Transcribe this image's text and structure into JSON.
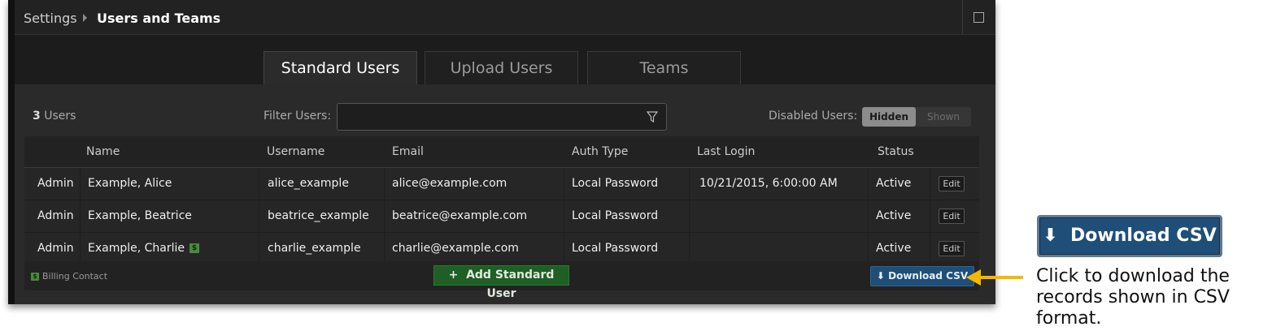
{
  "breadcrumb": {
    "root": "Settings",
    "current": "Users and Teams"
  },
  "tabs": [
    {
      "label": "Standard Users",
      "active": true
    },
    {
      "label": "Upload Users",
      "active": false
    },
    {
      "label": "Teams",
      "active": false
    }
  ],
  "toolbar": {
    "user_count": "3",
    "user_count_label": "Users",
    "filter_label": "Filter Users:",
    "filter_value": "",
    "disabled_label": "Disabled Users:",
    "toggle_hidden": "Hidden",
    "toggle_shown": "Shown",
    "toggle_selected": "Hidden"
  },
  "table": {
    "columns": [
      "Name",
      "Username",
      "Email",
      "Auth Type",
      "Last Login",
      "Status"
    ],
    "rows": [
      {
        "role": "Admin",
        "name": "Example, Alice",
        "username": "alice_example",
        "email": "alice@example.com",
        "auth": "Local Password",
        "last_login": "10/21/2015, 6:00:00 AM",
        "status": "Active",
        "edit": "Edit",
        "billing": false
      },
      {
        "role": "Admin",
        "name": "Example, Beatrice",
        "username": "beatrice_example",
        "email": "beatrice@example.com",
        "auth": "Local Password",
        "last_login": "",
        "status": "Active",
        "edit": "Edit",
        "billing": false
      },
      {
        "role": "Admin",
        "name": "Example, Charlie",
        "username": "charlie_example",
        "email": "charlie@example.com",
        "auth": "Local Password",
        "last_login": "",
        "status": "Active",
        "edit": "Edit",
        "billing": true
      }
    ]
  },
  "footer": {
    "billing_icon": "$",
    "billing_legend": "Billing Contact",
    "add_button": "Add Standard User",
    "download_button": "Download CSV"
  },
  "callout": {
    "button_label": "Download CSV",
    "text": "Click to download the records shown in CSV format.",
    "arrow_color": "#f5b800"
  },
  "colors": {
    "add_green": "#1f5e24",
    "download_blue": "#1f4e78",
    "billing_green": "#4a8a3e"
  }
}
